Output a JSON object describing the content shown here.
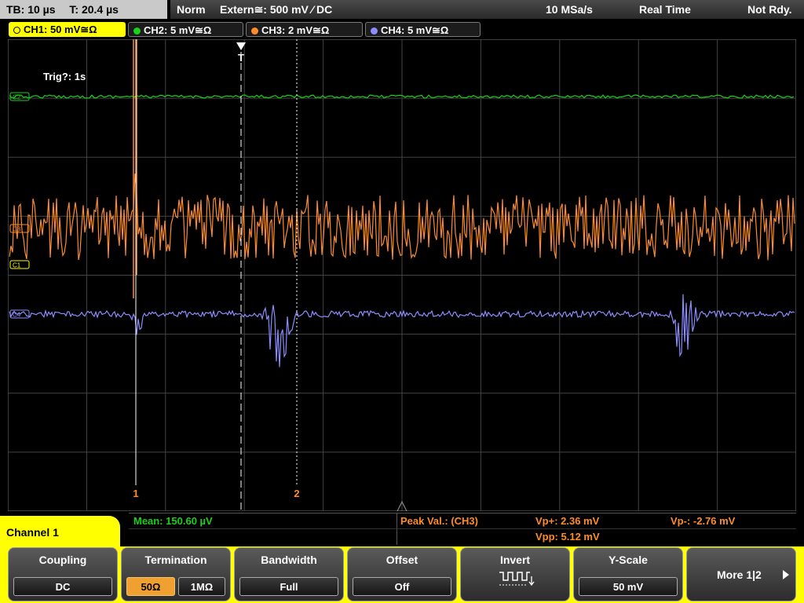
{
  "status": {
    "timebase": "TB: 10 µs",
    "trigger_time": "T: 20.4 µs",
    "mode": "Norm",
    "trigger_source": "Extern≅: 500 mV ⁄ DC",
    "sample_rate": "10 MSa/s",
    "acq_mode": "Real Time",
    "ready_state": "Not Rdy."
  },
  "channels": [
    {
      "label": "CH1: 50 mV≅Ω",
      "color": "#ffff00"
    },
    {
      "label": "CH2: 5 mV≅Ω",
      "color": "#19d219"
    },
    {
      "label": "CH3: 2 mV≅Ω",
      "color": "#ff8c28"
    },
    {
      "label": "CH4: 5 mV≅Ω",
      "color": "#8c8cff"
    }
  ],
  "markers": {
    "trigger_info": "Trig?: 1s",
    "trigger_marker": "T",
    "cursor1": "1",
    "cursor2": "2",
    "ch2_marker": "C2",
    "ch3_marker": "C3",
    "ch1_marker": "C1",
    "ch4_marker": "C4"
  },
  "measurements": {
    "mean": "Mean: 150.60 µV",
    "peak_label": "Peak Val.: (CH3)",
    "vp_plus": "Vp+: 2.36 mV",
    "vp_minus": "Vp-: -2.76 mV",
    "vpp": "Vpp: 5.12 mV"
  },
  "menu": {
    "channel_title": "Channel 1",
    "coupling": {
      "title": "Coupling",
      "value": "DC"
    },
    "termination": {
      "title": "Termination",
      "opt1": "50Ω",
      "opt2": "1MΩ"
    },
    "bandwidth": {
      "title": "Bandwidth",
      "value": "Full"
    },
    "offset": {
      "title": "Offset",
      "value": "Off"
    },
    "invert": {
      "title": "Invert"
    },
    "yscale": {
      "title": "Y-Scale",
      "value": "50 mV"
    },
    "more": "More 1|2"
  }
}
